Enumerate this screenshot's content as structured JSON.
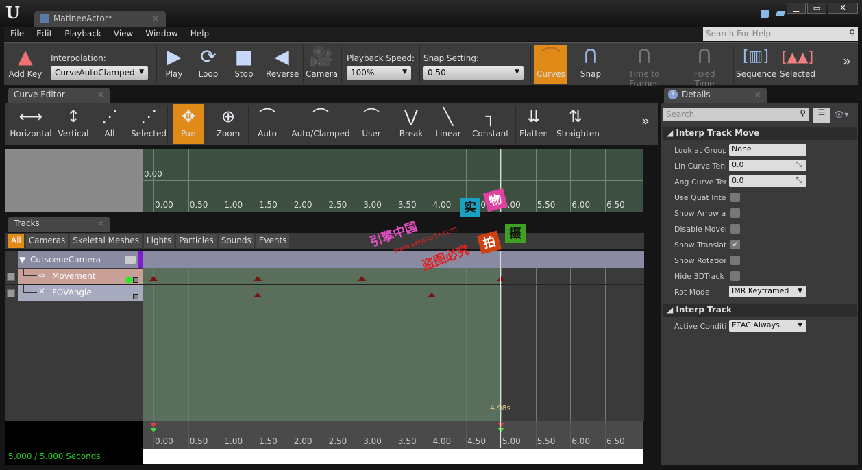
{
  "window": {
    "tab_title": "MatineeActor*",
    "controls": [
      "minimize",
      "maximize",
      "close"
    ]
  },
  "menu": [
    "File",
    "Edit",
    "Playback",
    "View",
    "Window",
    "Help"
  ],
  "help_search": {
    "placeholder": "Search For Help"
  },
  "toolbar": {
    "add_key": "Add Key",
    "interpolation_label": "Interpolation:",
    "interpolation_value": "CurveAutoClamped",
    "play": "Play",
    "loop": "Loop",
    "stop": "Stop",
    "reverse": "Reverse",
    "camera": "Camera",
    "speed_label": "Playback Speed:",
    "speed_value": "100%",
    "snap_label": "Snap Setting:",
    "snap_value": "0.50",
    "curves": "Curves",
    "snap": "Snap",
    "time_to_frames": "Time to Frames",
    "fixed_time": "Fixed Time",
    "sequence": "Sequence",
    "selected": "Selected"
  },
  "curve_editor": {
    "tab": "Curve Editor",
    "buttons": [
      "Horizontal",
      "Vertical",
      "All",
      "Selected",
      "Pan",
      "Zoom",
      "Auto",
      "Auto/Clamped",
      "User",
      "Break",
      "Linear",
      "Constant",
      "Flatten",
      "Straighten"
    ],
    "active": "Pan",
    "y_label": "0.00",
    "ticks": [
      "0.00",
      "0.50",
      "1.00",
      "1.50",
      "2.00",
      "2.50",
      "3.00",
      "3.50",
      "4.00",
      "4.50",
      "5.00",
      "5.50",
      "6.00",
      "6.50"
    ]
  },
  "tracks": {
    "tab": "Tracks",
    "filters": [
      "All",
      "Cameras",
      "Skeletal Meshes",
      "Lights",
      "Particles",
      "Sounds",
      "Events"
    ],
    "active_filter": "All",
    "group": "CutsceneCamera",
    "rows": [
      {
        "name": "Movement",
        "keys": [
          0,
          1.5,
          3.0,
          5.0
        ]
      },
      {
        "name": "FOVAngle",
        "keys": [
          1.5,
          4.0
        ]
      }
    ],
    "sequence_length": 5.0,
    "playhead_label": "4.98s",
    "status": "5.000 / 5.000 Seconds"
  },
  "details": {
    "tab": "Details",
    "search_placeholder": "Search",
    "section1": "Interp Track Move",
    "props": [
      {
        "label": "Look at Group N",
        "type": "text",
        "value": "None"
      },
      {
        "label": "Lin Curve Tens",
        "type": "num",
        "value": "0.0"
      },
      {
        "label": "Ang Curve Tens",
        "type": "num",
        "value": "0.0"
      },
      {
        "label": "Use Quat Interp",
        "type": "check",
        "value": false
      },
      {
        "label": "Show Arrow at",
        "type": "check",
        "value": false
      },
      {
        "label": "Disable Movem",
        "type": "check",
        "value": false
      },
      {
        "label": "Show Translati",
        "type": "check",
        "value": true
      },
      {
        "label": "Show Rotation",
        "type": "check",
        "value": false
      },
      {
        "label": "Hide 3DTrack",
        "type": "check",
        "value": false
      },
      {
        "label": "Rot Mode",
        "type": "combo",
        "value": "IMR Keyframed"
      }
    ],
    "section2": "Interp Track",
    "props2": [
      {
        "label": "Active Conditio",
        "type": "combo",
        "value": "ETAC Always"
      }
    ]
  },
  "watermark": {
    "line1": "引擎中国",
    "line2": "www.enginedx.com",
    "line3": "盗图必究",
    "stamps": [
      "实",
      "物",
      "拍",
      "摄"
    ]
  },
  "colors": {
    "accent": "#e08a1a",
    "track_bg": "#3c4f40",
    "status": "#22cc22"
  }
}
